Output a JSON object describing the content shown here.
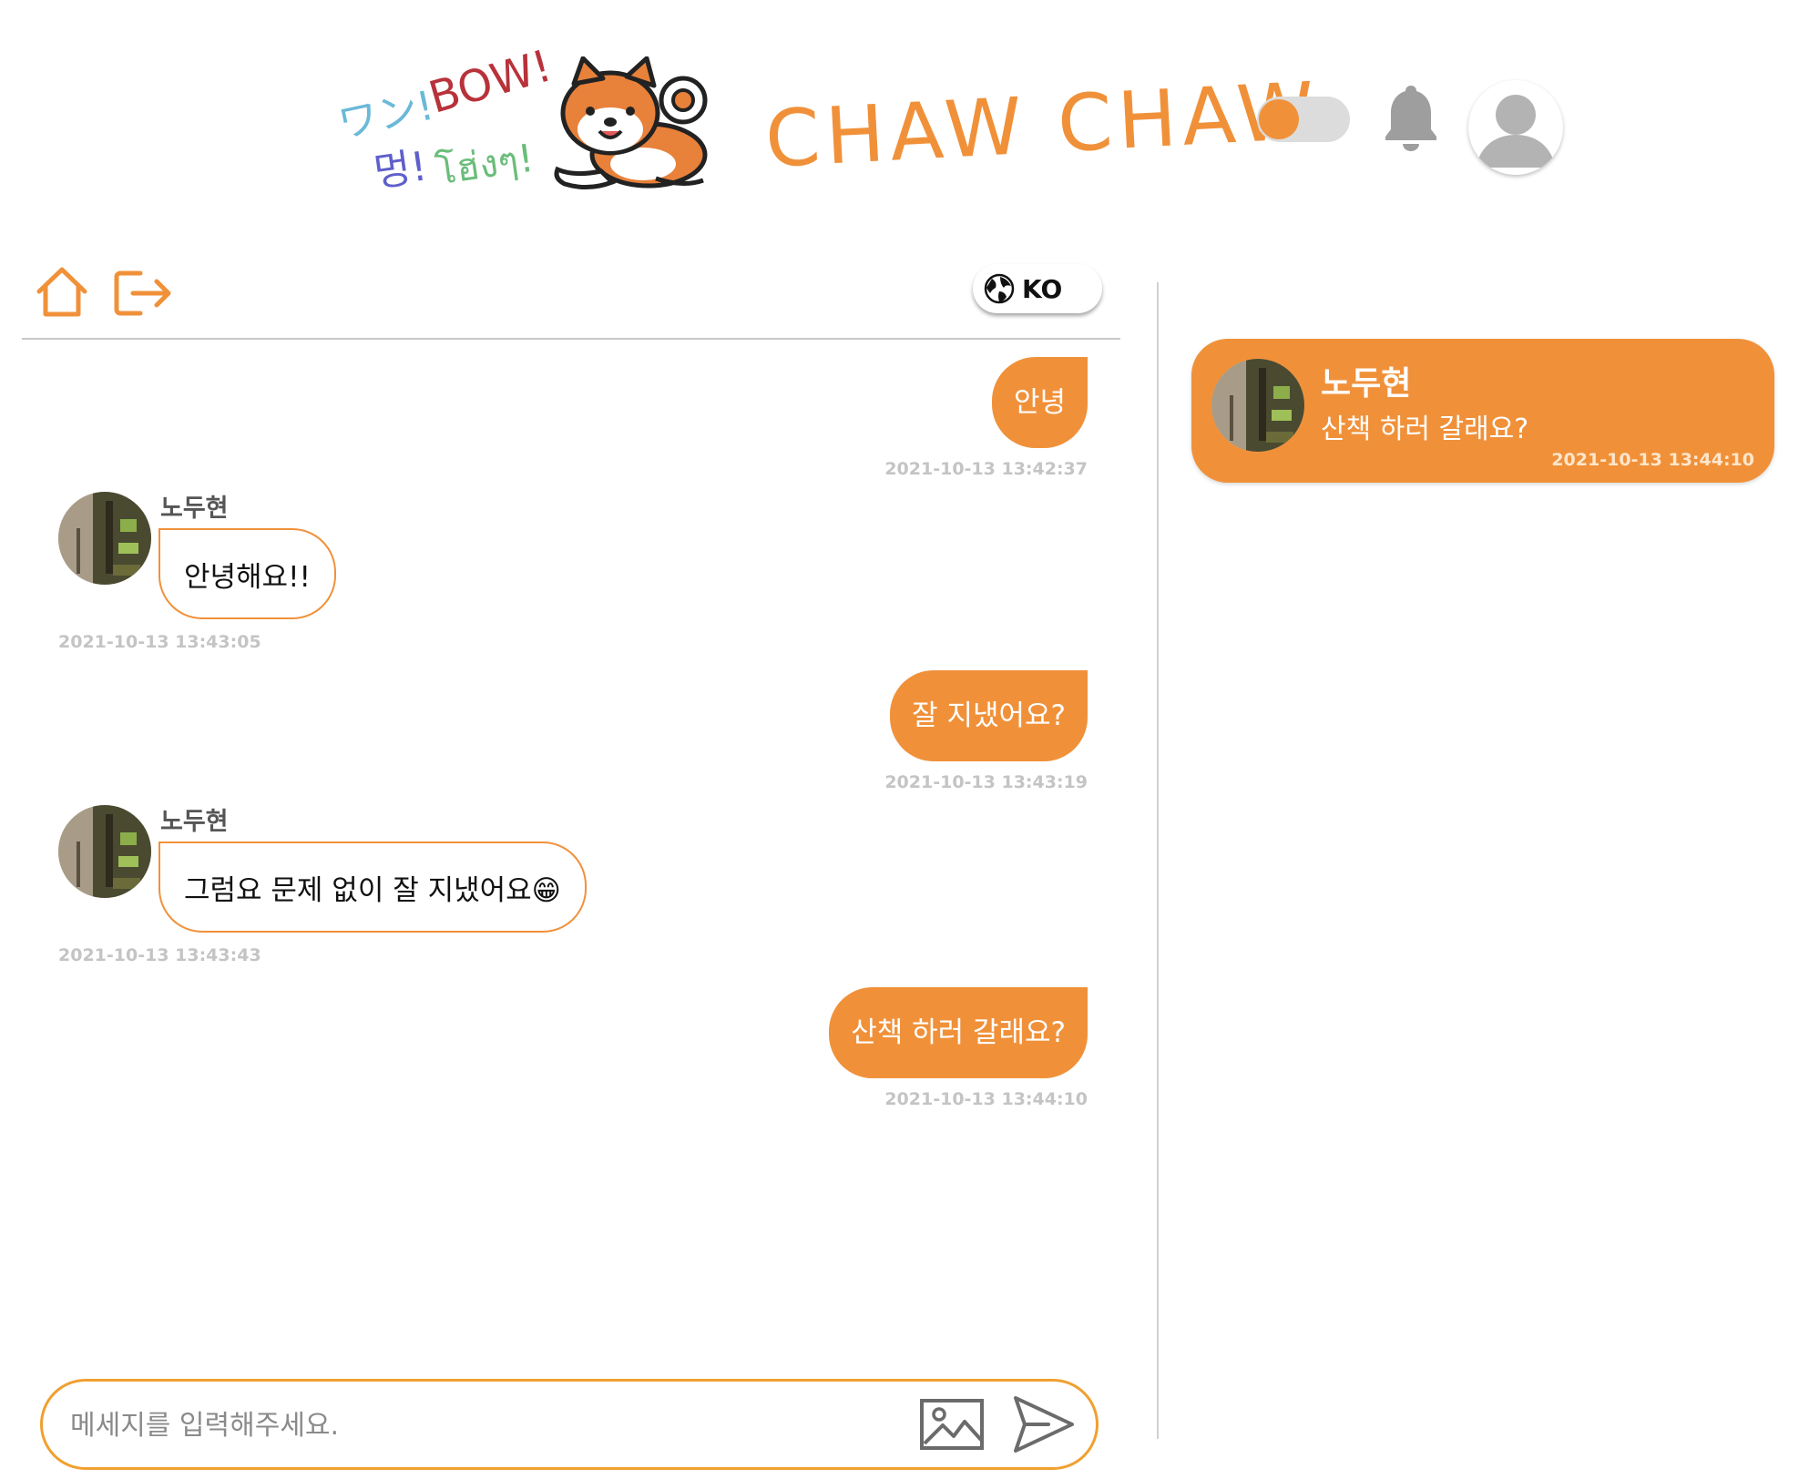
{
  "header": {
    "barks": [
      "ワン!",
      "BOW!",
      "멍!",
      "โฮ่งๆ!"
    ],
    "logo": "CHAW CHAW",
    "theme_toggle": {
      "on": true
    },
    "accent_color": "#f0913a"
  },
  "toolbar": {
    "home_icon": "home-icon",
    "exit_icon": "exit-icon",
    "language": "KO"
  },
  "chat": {
    "messages": [
      {
        "direction": "out",
        "text": "안녕",
        "time": "2021-10-13 13:42:37"
      },
      {
        "direction": "in",
        "sender": "노두현",
        "text": "안녕해요!!",
        "time": "2021-10-13 13:43:05"
      },
      {
        "direction": "out",
        "text": "잘 지냈어요?",
        "time": "2021-10-13 13:43:19"
      },
      {
        "direction": "in",
        "sender": "노두현",
        "text": "그럼요 문제 없이 잘 지냈어요😁",
        "time": "2021-10-13 13:43:43"
      },
      {
        "direction": "out",
        "text": "산책 하러 갈래요?",
        "time": "2021-10-13 13:44:10"
      }
    ]
  },
  "composer": {
    "placeholder": "메세지를 입력해주세요.",
    "value": ""
  },
  "notification": {
    "sender": "노두현",
    "text": "산책 하러 갈래요?",
    "time": "2021-10-13 13:44:10"
  }
}
